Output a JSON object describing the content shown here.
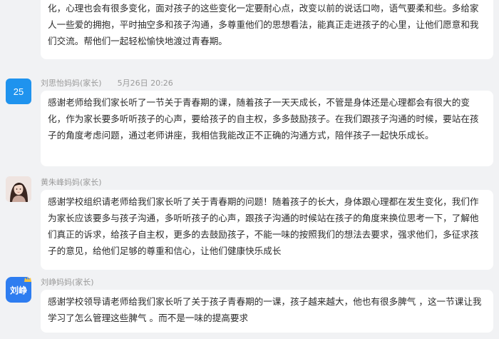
{
  "comments": [
    {
      "text": "感谢老师给我们家长上了一节关于孩子青春期的一课讲座，让我们懂得了青春期的孩子不但身体发生了一些变化，心理也会有很多变化，面对孩子的这些变化一定要耐心点，改变以前的说话口吻，语气要柔和些。多给家人一些爱的拥抱，平时抽空多和孩子沟通，多尊重他们的思想看法，能真正走进孩子的心里，让他们愿意和我们交流。帮他们一起轻松愉快地渡过青春期。"
    },
    {
      "avatar_text": "25",
      "author": "刘思怡妈妈(家长)",
      "time": "5月26日 20:26",
      "text": "感谢老师给我们家长听了一节关于青春期的课，随着孩子一天天成长，不管是身体还是心理都会有很大的变化，作为家长要多听听孩子的心声，要给孩子的自主权，多多鼓励孩子。在我们跟孩子沟通的时候，要站在孩子的角度考虑问题，通过老师讲座，我相信我能改正不正确的沟通方式，陪伴孩子一起快乐成长。"
    },
    {
      "avatar_icon": "user-photo",
      "author": "黄朱峰妈妈(家长)",
      "text": "感谢学校组织请老师给我们家长听了关于青春期的问题！随着孩子的长大，身体跟心理都在发生变化，我们作为家长应该要多与孩子沟通，多听听孩子的心声，跟孩子沟通的时候站在孩子的角度来换位思考一下，了解他们真正的诉求，给孩子自主权，更多的去鼓励孩子，不能一味的按照我们的想法去要求，强求他们，多征求孩子的意见，给他们足够的尊重和信心，让他们健康快乐成长"
    },
    {
      "avatar_text": "刘峥",
      "author": "刘峥妈妈(家长)",
      "text": "感谢学校领导请老师给我们家长听了关于孩子青春期的一课，孩子越来越大，他也有很多脾气 ，这一节课让我学习了怎么管理这些脾气 。而不是一味的提高要求"
    }
  ],
  "colors": {
    "background": "#f1f2f4",
    "bubble": "#ffffff",
    "meta_text": "#9a9a9a",
    "avatar_blue": "#1f93ee",
    "badge_blue": "#2e7df0"
  }
}
